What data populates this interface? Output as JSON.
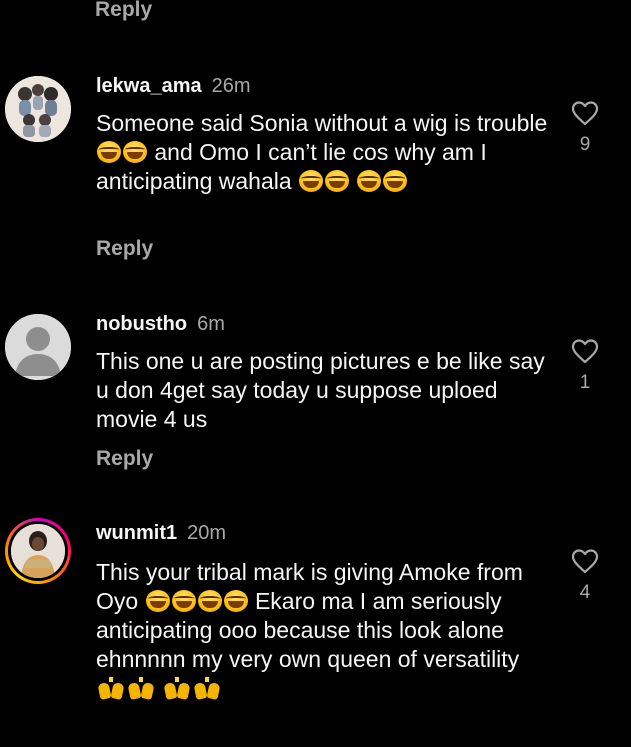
{
  "top_reply_label": "Reply",
  "comments": [
    {
      "username": "lekwa_ama",
      "time": "26m",
      "text_parts": [
        "Someone said Sonia without a wig is trouble ",
        " and Omo I can’t lie cos why am I anticipating wahala ",
        ""
      ],
      "emoji": "face-with-tears-of-joy",
      "reply_label": "Reply",
      "likes": "9"
    },
    {
      "username": "nobustho",
      "time": "6m",
      "text": "This one u are posting pictures e be like say u don 4get say today u suppose uploed movie 4 us",
      "reply_label": "Reply",
      "likes": "1"
    },
    {
      "username": "wunmit1",
      "time": "20m",
      "text_parts": [
        "This your tribal mark is giving Amoke from Oyo ",
        " Ekaro ma  I am seriously anticipating ooo because this look alone ehnnnnn my very own queen of versatility "
      ],
      "emoji": "face-with-tears-of-joy",
      "emoji_2": "raising-hands",
      "likes": "4"
    }
  ],
  "colors": {
    "background": "#000000",
    "primary_text": "#f5f5f5",
    "secondary_text": "#a8a8a8"
  }
}
